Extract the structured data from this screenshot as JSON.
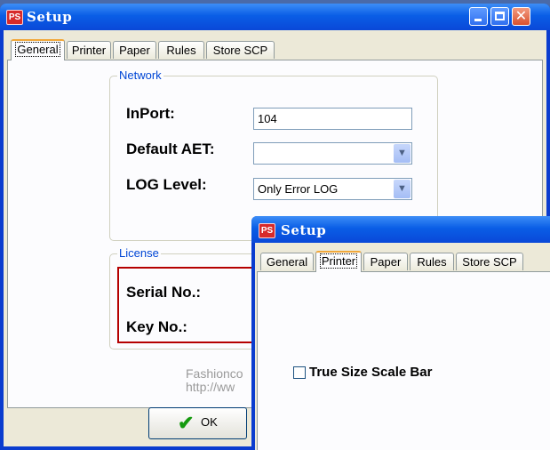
{
  "main_window": {
    "icon_label": "PS",
    "title": "Setup",
    "tabs": [
      {
        "label": "General"
      },
      {
        "label": "Printer"
      },
      {
        "label": "Paper"
      },
      {
        "label": "Rules"
      },
      {
        "label": "Store SCP"
      }
    ],
    "active_tab": "General",
    "network": {
      "label": "Network",
      "inport_label": "InPort:",
      "inport_value": "104",
      "default_aet_label": "Default AET:",
      "default_aet_value": "",
      "log_level_label": "LOG Level:",
      "log_level_value": "Only Error LOG"
    },
    "license": {
      "label": "License",
      "serial_label": "Serial No.:",
      "key_label": "Key No.:"
    },
    "watermark": {
      "line1": "Fashionco",
      "line2": "http://ww"
    },
    "ok_label": "OK"
  },
  "second_window": {
    "icon_label": "PS",
    "title": "Setup",
    "tabs": [
      {
        "label": "General"
      },
      {
        "label": "Printer"
      },
      {
        "label": "Paper"
      },
      {
        "label": "Rules"
      },
      {
        "label": "Store SCP"
      }
    ],
    "active_tab": "Printer",
    "true_size_label": "True Size Scale Bar",
    "true_size_checked": false
  },
  "icons": {
    "minimize": "minimize-icon",
    "maximize": "maximize-icon",
    "close": "close-icon",
    "dropdown": "chevron-down-icon",
    "ok": "checkmark-icon"
  },
  "colors": {
    "title_bar": "#0a5ee6",
    "active_tab_accent": "#f1a83a",
    "group_label": "#0046d5",
    "license_border": "#b50000",
    "ok_check": "#159a0f"
  }
}
